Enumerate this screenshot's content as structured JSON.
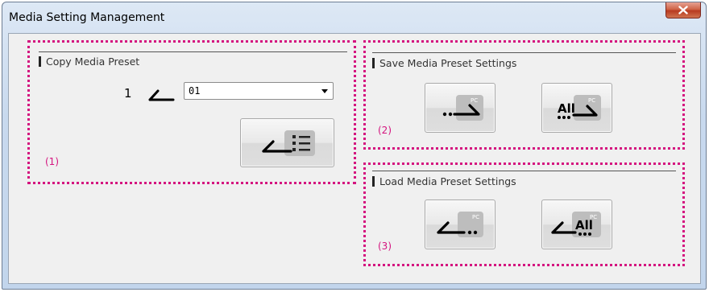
{
  "window": {
    "title": "Media Setting Management"
  },
  "copy": {
    "label": "Copy Media Preset",
    "number": "1",
    "select_value": "01",
    "note": "(1)"
  },
  "save": {
    "label": "Save Media Preset Settings",
    "note": "(2)",
    "one_badge": "PC",
    "all_text": "All",
    "all_badge": "PC"
  },
  "load": {
    "label": "Load Media Preset Settings",
    "note": "(3)",
    "one_badge": "PC",
    "all_text": "All",
    "all_badge": "PC"
  },
  "colors": {
    "accent_dotted": "#d4147f"
  }
}
